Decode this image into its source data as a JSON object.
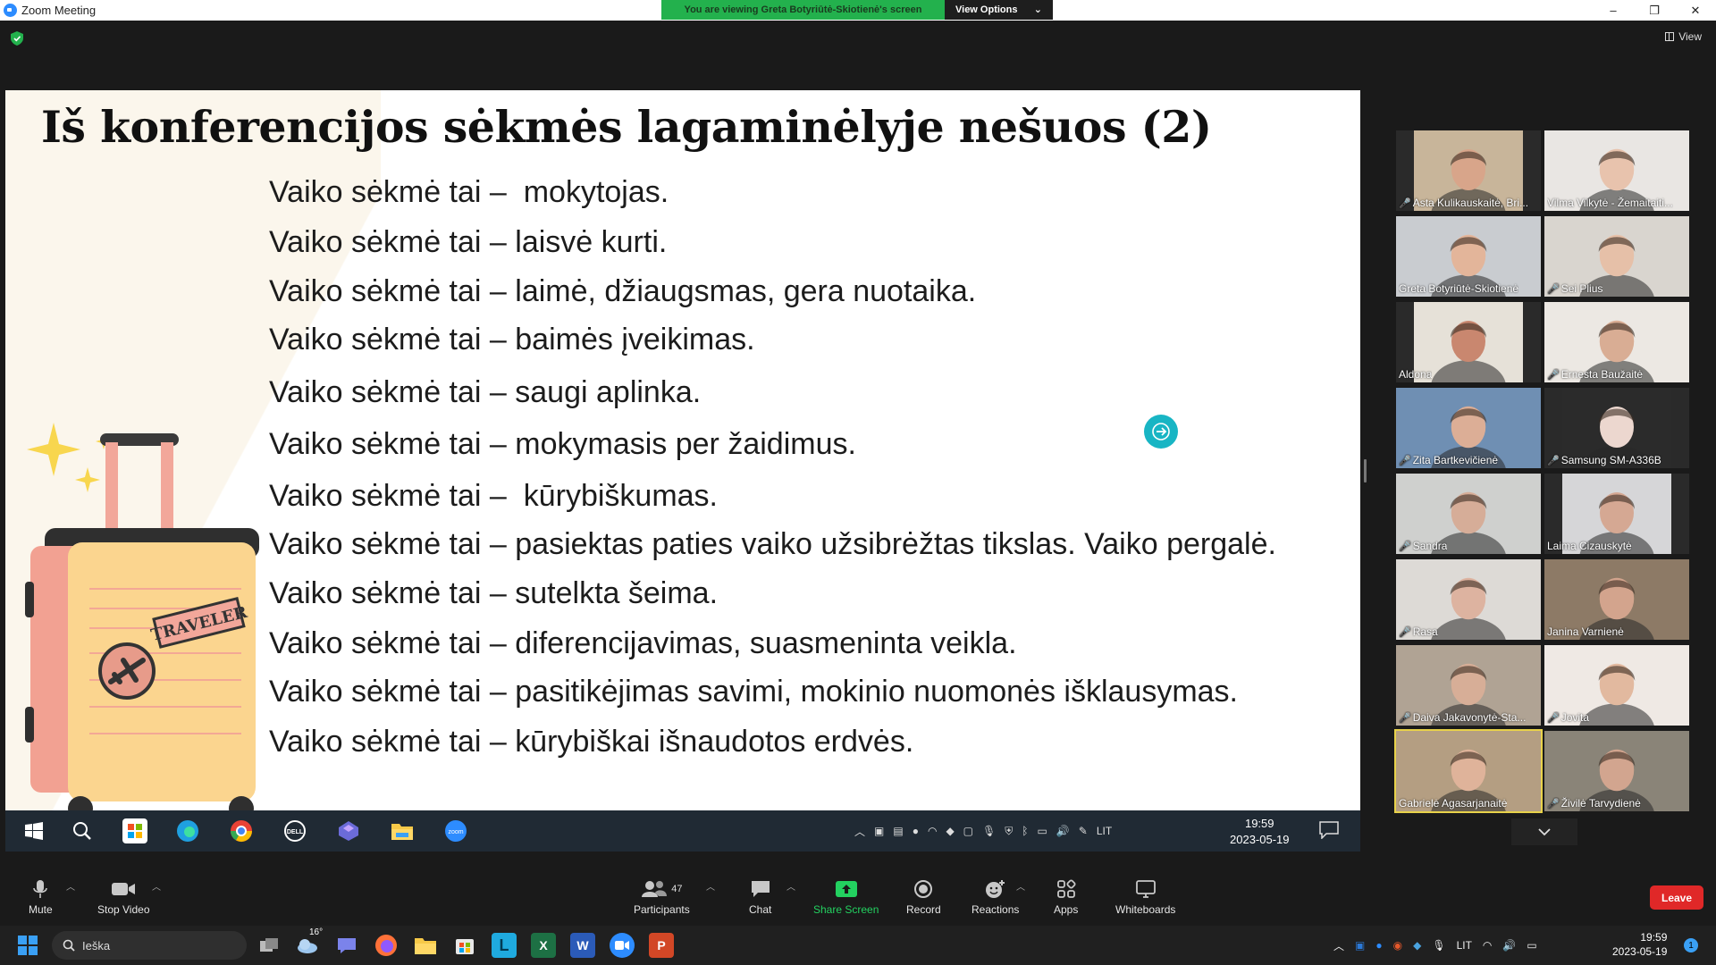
{
  "window": {
    "title": "Zoom Meeting",
    "controls": [
      "–",
      "❐",
      "✕"
    ]
  },
  "banner": {
    "message": "You are viewing Greta Botyriūtė-Skiotienė's screen",
    "options_label": "View Options",
    "caret": "⌄"
  },
  "view_label": "View",
  "slide": {
    "title": "Iš konferencijos sėkmės lagaminėlyje nešuos (2)",
    "lines": [
      "Vaiko sėkmė tai –  mokytojas.",
      "Vaiko sėkmė tai – laisvė kurti.",
      "Vaiko sėkmė tai – laimė, džiaugsmas, gera nuotaika.",
      "Vaiko sėkmė tai – baimės įveikimas.",
      "Vaiko sėkmė tai – saugi aplinka.",
      "Vaiko sėkmė tai – mokymasis per žaidimus.",
      "Vaiko sėkmė tai –  kūrybiškumas.",
      "Vaiko sėkmė tai – pasiektas paties vaiko užsibrėžtas tikslas. Vaiko pergalė.",
      "Vaiko sėkmė tai – sutelkta šeima.",
      "Vaiko sėkmė tai – diferencijavimas, suasmeninta veikla.",
      "Vaiko sėkmė tai – pasitikėjimas savimi, mokinio nuomonės išklausymas.",
      "Vaiko sėkmė tai – kūrybiškai išnaudotos erdvės."
    ],
    "suitcase_tag": "TRAVELER"
  },
  "remote_taskbar": {
    "time": "19:59",
    "date": "2023-05-19",
    "lang": "LIT"
  },
  "participants_tiles": [
    {
      "name": "Asta Kulikauskaitė, Bri...",
      "muted": true,
      "bg": "#c8b59a",
      "skin": "#d8a58a"
    },
    {
      "name": "Vilma Vilkytė - Žemaitaiti...",
      "muted": false,
      "bg": "#e9e6e3",
      "skin": "#e8c3ad"
    },
    {
      "name": "Greta Botyriūtė-Skiotienė",
      "muted": false,
      "bg": "#c9ccd0",
      "skin": "#e3b59a"
    },
    {
      "name": "Sei Plius",
      "muted": true,
      "bg": "#d9d5cf",
      "skin": "#e6c0a8"
    },
    {
      "name": "Aldona",
      "muted": false,
      "bg": "#e6e1d8",
      "skin": "#c9876f"
    },
    {
      "name": "Ernesta Baužaitė",
      "muted": true,
      "bg": "#ece8e3",
      "skin": "#d9ad94"
    },
    {
      "name": "Zita Bartkevičienė",
      "muted": true,
      "bg": "#6f8fb3",
      "skin": "#dcae96"
    },
    {
      "name": "Samsung SM-A336B",
      "muted": true,
      "bg": "#2b2b2b",
      "skin": "#ecd7cf"
    },
    {
      "name": "Sandra",
      "muted": true,
      "bg": "#cfd0ce",
      "skin": "#d6ad98"
    },
    {
      "name": "Laima Cizauskytė",
      "muted": false,
      "bg": "#d6d6d8",
      "skin": "#d5a893"
    },
    {
      "name": "Rasa",
      "muted": true,
      "bg": "#dddad6",
      "skin": "#ddb3a0"
    },
    {
      "name": "Janina Varnienė",
      "muted": false,
      "bg": "#8d7a66",
      "skin": "#d3a48d"
    },
    {
      "name": "Daiva Jakavonytė-Sta...",
      "muted": true,
      "bg": "#b0a394",
      "skin": "#d7ae97"
    },
    {
      "name": "Jovita",
      "muted": true,
      "bg": "#efe9e4",
      "skin": "#e2b99f"
    },
    {
      "name": "Gabrielė Agasarjanaitė",
      "muted": false,
      "bg": "#b49e82",
      "skin": "#dfb39a",
      "active": true
    },
    {
      "name": "Živilė Tarvydienė",
      "muted": true,
      "bg": "#8a8478",
      "skin": "#d2a58f"
    }
  ],
  "controls": {
    "mute": "Mute",
    "stop_video": "Stop Video",
    "participants": "Participants",
    "participants_count": "47",
    "chat": "Chat",
    "share_screen": "Share Screen",
    "record": "Record",
    "reactions": "Reactions",
    "apps": "Apps",
    "whiteboards": "Whiteboards",
    "leave": "Leave"
  },
  "taskbar": {
    "search_placeholder": "Ieška",
    "weather": "16°",
    "lang": "LIT",
    "time": "19:59",
    "date": "2023-05-19",
    "notifications": "1"
  }
}
